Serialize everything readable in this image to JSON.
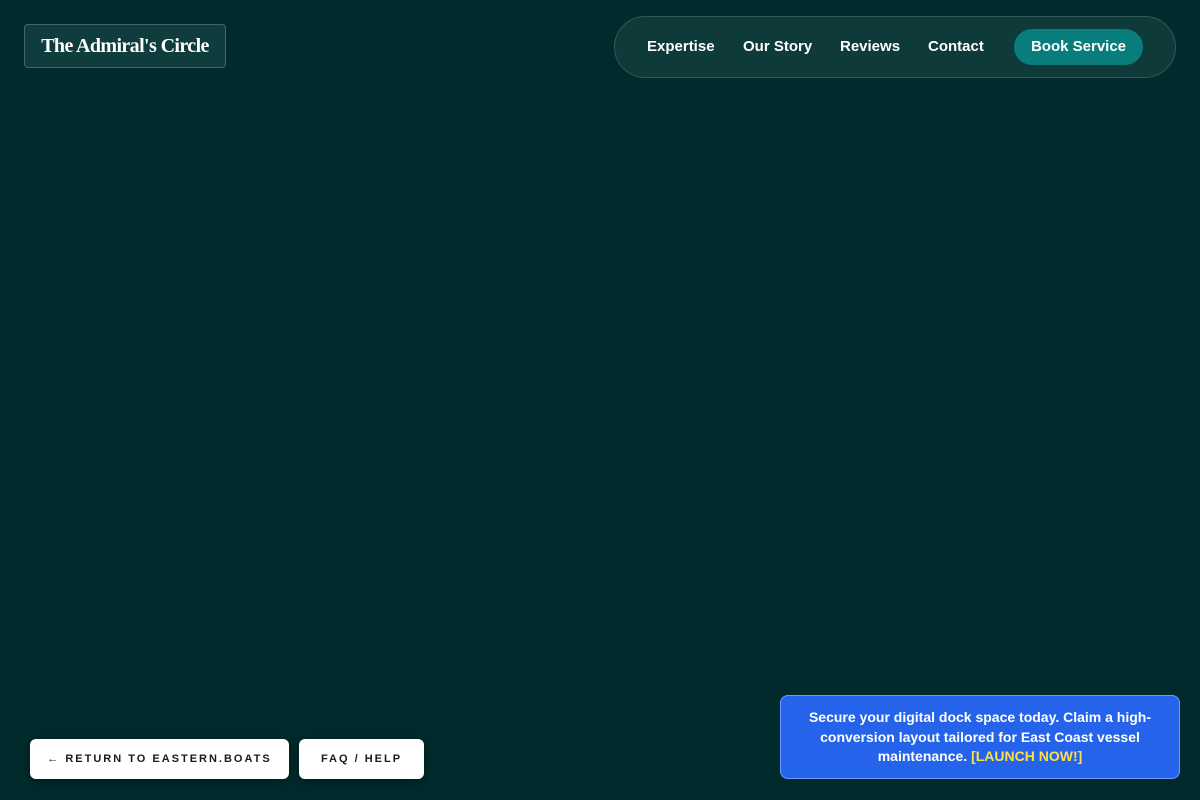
{
  "brand": {
    "name": "The Admiral's Circle"
  },
  "nav": {
    "links": [
      {
        "label": "Expertise"
      },
      {
        "label": "Our Story"
      },
      {
        "label": "Reviews"
      },
      {
        "label": "Contact"
      }
    ],
    "cta_label": "Book Service"
  },
  "footer_buttons": {
    "return_label": "← RETURN TO EASTERN.BOATS",
    "faq_label": "FAQ / HELP"
  },
  "promo": {
    "text": "Secure your digital dock space today. Claim a high-conversion layout tailored for East Coast vessel maintenance.",
    "cta": "[LAUNCH NOW!]"
  },
  "colors": {
    "background": "#002a2b",
    "nav_background": "#0f3a3a",
    "cta_teal": "#087d7c",
    "promo_blue": "#2563eb",
    "promo_highlight": "#fde047"
  }
}
